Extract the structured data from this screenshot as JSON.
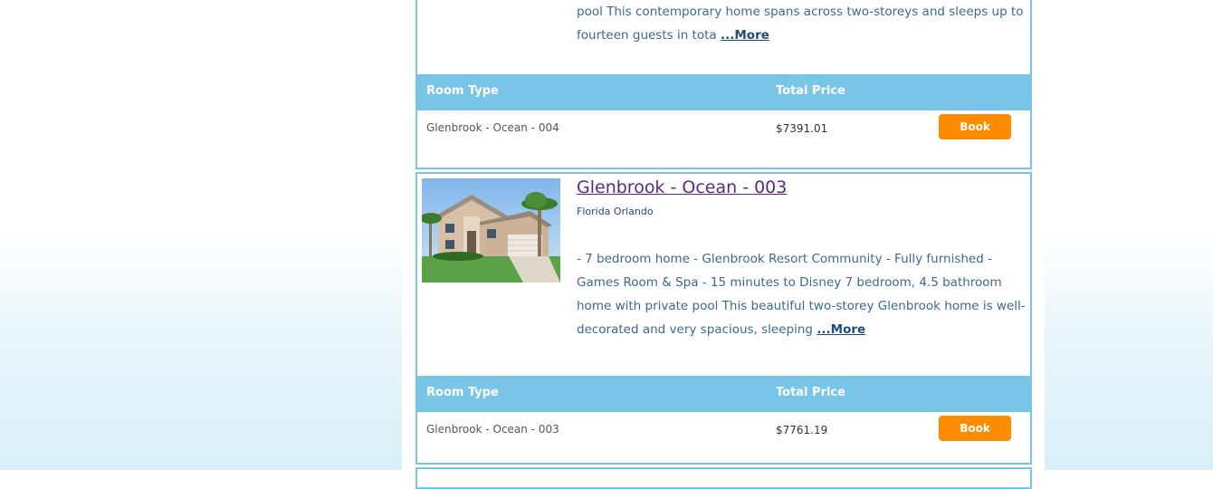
{
  "listings": [
    {
      "description": "pool This contemporary home spans across two-storeys and sleeps up to fourteen guests in tota",
      "more_label": "...More",
      "room_table": {
        "header_room_type": "Room Type",
        "header_total_price": "Total Price",
        "rows": [
          {
            "room_type": "Glenbrook - Ocean - 004",
            "total_price": "$7391.01",
            "book_label": "Book"
          }
        ]
      }
    },
    {
      "title": "Glenbrook - Ocean - 003",
      "location": "Florida Orlando",
      "description": "- 7 bedroom home - Glenbrook Resort Community - Fully furnished - Games Room & Spa - 15 minutes to Disney 7 bedroom, 4.5 bathroom home with private pool This beautiful two-storey Glenbrook home is well-decorated and very spacious, sleeping",
      "more_label": "...More",
      "room_table": {
        "header_room_type": "Room Type",
        "header_total_price": "Total Price",
        "rows": [
          {
            "room_type": "Glenbrook - Ocean - 003",
            "total_price": "$7761.19",
            "book_label": "Book"
          }
        ]
      }
    }
  ],
  "colors": {
    "accent_blue": "#78c5e8",
    "book_orange": "#ff8c00",
    "title_link": "#5a2a82"
  }
}
